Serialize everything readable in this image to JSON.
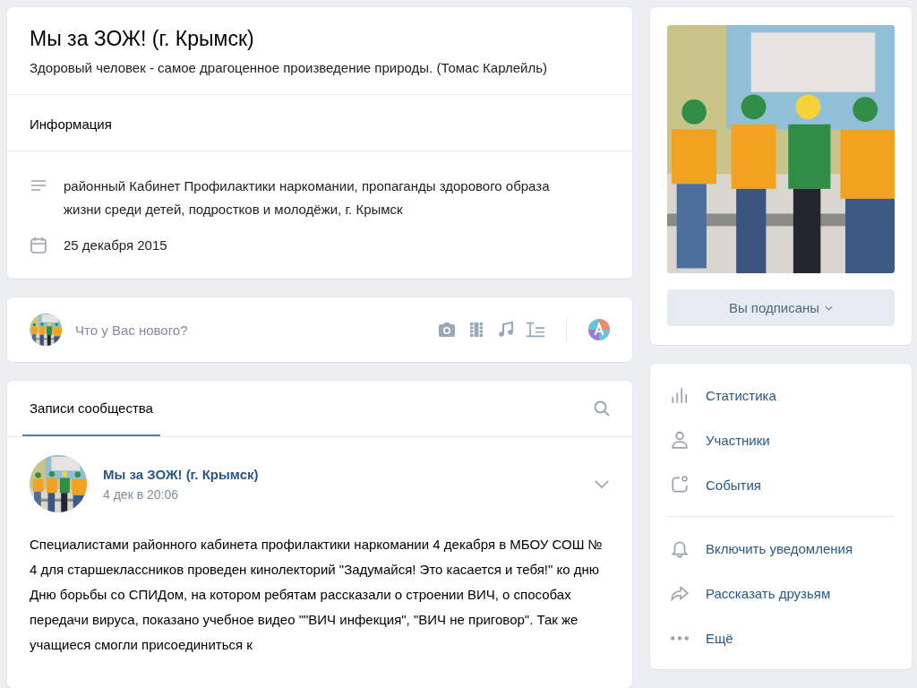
{
  "group": {
    "title": "Мы за ЗОЖ! (г. Крымск)",
    "status": "Здоровый человек - самое драгоценное произведение природы. (Томас Карлейль)",
    "section": "Информация",
    "info": [
      {
        "kind": "description",
        "text": "районный Кабинет Профилактики наркомании, пропаганды здорового образа жизни среди детей, подростков и молодёжи, г. Крымск"
      },
      {
        "kind": "date",
        "text": "25 декабря 2015"
      }
    ]
  },
  "composer": {
    "placeholder": "Что у Вас нового?"
  },
  "wall": {
    "tabs": [
      {
        "label": "Записи сообщества",
        "selected": true
      }
    ],
    "post": {
      "author": "Мы за ЗОЖ! (г. Крымск)",
      "time": "4 дек в 20:06",
      "text": "Специалистами районного кабинета профилактики наркомании 4 декабря в МБОУ СОШ № 4 для старшеклассников проведен кинолекторий \"Задумайся! Это касается и тебя!\" ко дню Дню борьбы со СПИДом, на котором ребятам рассказали о строении ВИЧ, о способах передачи вируса, показано учебное видео \"\"ВИЧ инфекция\", \"ВИЧ не приговор\". Так же учащиеся смогли присоединиться к"
    }
  },
  "side": {
    "subscribe_button": "Вы подписаны",
    "menu": [
      {
        "kind": "stats",
        "label": "Статистика"
      },
      {
        "kind": "members",
        "label": "Участники"
      },
      {
        "kind": "events",
        "label": "События"
      },
      {
        "kind": "divider"
      },
      {
        "kind": "bell",
        "label": "Включить уведомления"
      },
      {
        "kind": "share",
        "label": "Рассказать друзьям"
      },
      {
        "kind": "more",
        "label": "Ещё"
      }
    ]
  }
}
